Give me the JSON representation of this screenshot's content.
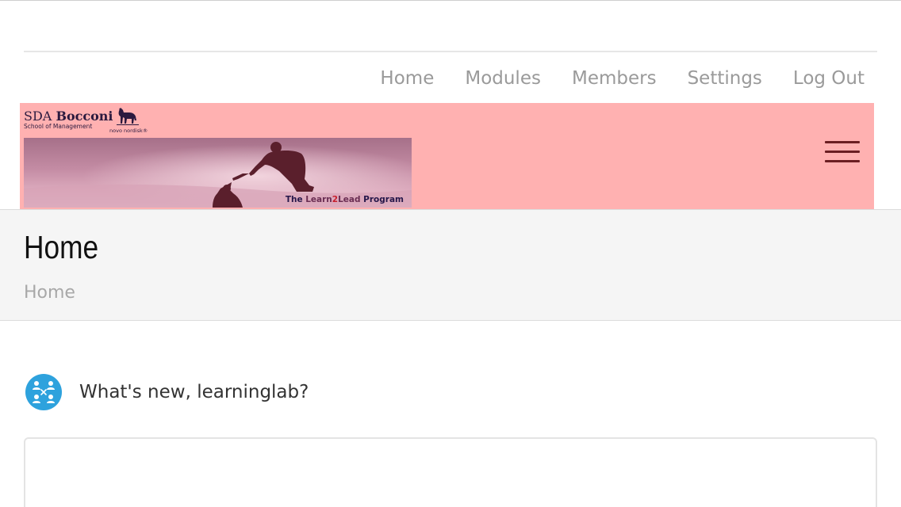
{
  "top_nav": {
    "items": [
      {
        "label": "Home"
      },
      {
        "label": "Modules"
      },
      {
        "label": "Members"
      },
      {
        "label": "Settings"
      },
      {
        "label": "Log Out"
      }
    ]
  },
  "header": {
    "brand_sda_light": "SDA ",
    "brand_sda_bold": "Bocconi",
    "brand_school": "School of Management",
    "brand_novo": "novo nordisk®",
    "banner_caption_part1": "The ",
    "banner_caption_learn": "Learn",
    "banner_caption_two": "2",
    "banner_caption_lead": "Lead",
    "banner_caption_part3": " Program",
    "band_color": "#ffb1b1",
    "menu_icon": "hamburger-menu-icon"
  },
  "page_title": "Home",
  "breadcrumb": "Home",
  "activity": {
    "prompt": "What's new, learninglab?",
    "avatar_icon": "group-network-icon",
    "avatar_color": "#2ea2dd"
  },
  "colors": {
    "nav_text": "#9a9a9a",
    "title_band": "#f5f5f5",
    "hamburger": "#6b1e22"
  }
}
